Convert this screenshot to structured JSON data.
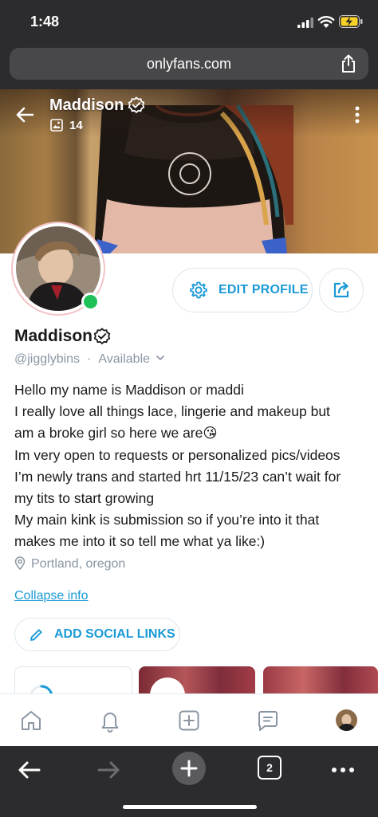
{
  "status_bar": {
    "time": "1:48"
  },
  "browser": {
    "url": "onlyfans.com",
    "tab_count": "2"
  },
  "cover": {
    "name": "Maddison",
    "media_count": "14"
  },
  "profile": {
    "name": "Maddison",
    "handle": "@jigglybins",
    "availability": "Available",
    "edit_label": "EDIT PROFILE",
    "bio": [
      "Hello my name is Maddison or maddi",
      "I really love all things lace, lingerie and makeup but",
      "am a broke girl so here we are😘",
      "Im very open to requests or personalized pics/videos",
      "I’m newly trans and started hrt 11/15/23 can’t wait for",
      "my tits to start growing",
      "My main kink is submission so if you’re into it that",
      "makes me into it so tell me what ya like:)"
    ],
    "location": "Portland, oregon",
    "collapse_label": "Collapse info",
    "social_label": "ADD SOCIAL LINKS"
  },
  "colors": {
    "accent": "#1b9ad6",
    "muted": "#8a96a3",
    "online": "#21c15a",
    "browser_bg": "#2c2c2e"
  },
  "icons": {
    "status": [
      "signal-icon",
      "wifi-icon",
      "battery-charging-icon"
    ],
    "nav": [
      "home-icon",
      "bell-icon",
      "add-post-icon",
      "messages-icon",
      "avatar"
    ],
    "browser": [
      "back-icon",
      "forward-icon",
      "new-tab-icon",
      "tabs-icon",
      "more-icon"
    ]
  }
}
